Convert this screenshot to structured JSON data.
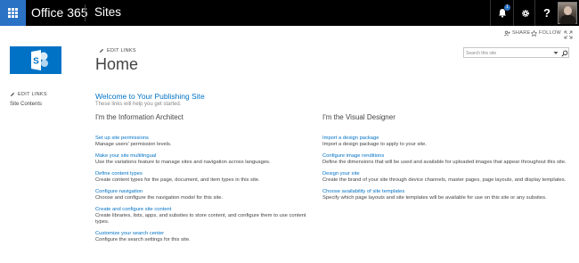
{
  "suite_bar": {
    "brand": "Office 365",
    "app_name": "Sites",
    "notification_count": "1",
    "help_glyph": "?",
    "accent_color": "#2a72c4",
    "icons": [
      "app-launcher-icon",
      "bell-icon",
      "gear-icon",
      "help-icon"
    ]
  },
  "ribbon": {
    "share_label": "SHARE",
    "follow_label": "FOLLOW"
  },
  "header": {
    "edit_links_label": "EDIT LINKS",
    "page_title": "Home",
    "search_placeholder": "Search this site",
    "logo_color": "#0072c6"
  },
  "left_nav": {
    "edit_links_label": "EDIT LINKS",
    "items": [
      {
        "label": "Site Contents"
      }
    ]
  },
  "main": {
    "welcome_title": "Welcome to Your Publishing Site",
    "welcome_subtitle": "These links will help you get started.",
    "left_column": {
      "heading": "I'm the Information Architect",
      "tasks": [
        {
          "link": "Set up site permissions",
          "desc": "Manage users' permission levels."
        },
        {
          "link": "Make your site multilingual",
          "desc": "Use the variations feature to manage sites and navigation across languages."
        },
        {
          "link": "Define content types",
          "desc": "Create content types for the page, document, and item types in this site."
        },
        {
          "link": "Configure navigation",
          "desc": "Choose and configure the navigation model for this site."
        },
        {
          "link": "Create and configure site content",
          "desc": "Create libraries, lists, apps, and subsites to store content, and configure them to use content types."
        },
        {
          "link": "Customize your search center",
          "desc": "Configure the search settings for this site."
        }
      ]
    },
    "right_column": {
      "heading": "I'm the Visual Designer",
      "tasks": [
        {
          "link": "Import a design package",
          "desc": "Import a design package to apply to your site."
        },
        {
          "link": "Configure image renditions",
          "desc": "Define the dimensions that will be used and available for uploaded images that appear throughout this site."
        },
        {
          "link": "Design your site",
          "desc": "Create the brand of your site through device channels, master pages, page layouts, and display templates."
        },
        {
          "link": "Choose availability of site templates",
          "desc": "Specify which page layouts and site templates will be available for use on this site or any subsites."
        }
      ]
    }
  }
}
